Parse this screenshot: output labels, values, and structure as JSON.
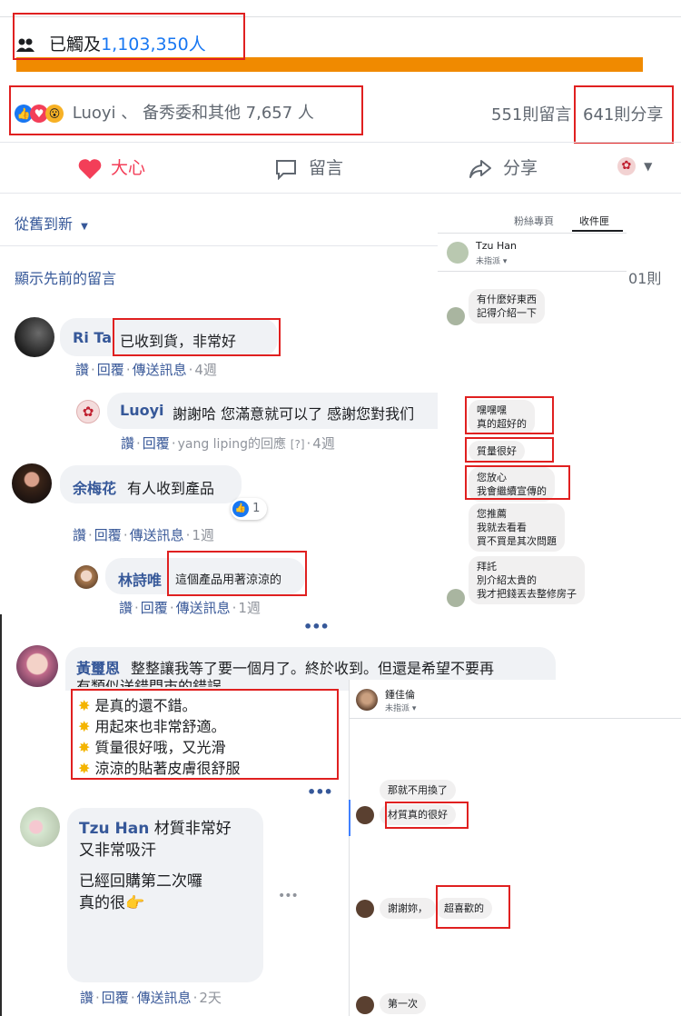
{
  "reach": {
    "prefix": "已觸及",
    "count": "1,103,350人"
  },
  "reactions": {
    "names": "Luoyi 、 备秀委和其他 7,657 人",
    "comments": "551則留言",
    "shares": "641則分享"
  },
  "actions": {
    "love": "大心",
    "comment": "留言",
    "share": "分享"
  },
  "sort": {
    "label": "從舊到新"
  },
  "show_previous": "顯示先前的留言",
  "comments_count_cut": "01則",
  "comment_actions": {
    "like": "讚",
    "reply": "回覆",
    "send": "傳送訊息"
  },
  "comments": [
    {
      "name": "Ri Ta",
      "text": "已收到貨，非常好",
      "time": "4週"
    },
    {
      "name": "Luoyi",
      "text": "謝謝哈 您滿意就可以了 感謝您對我们",
      "replied_by": "yang liping的回應",
      "badge": "[?]",
      "time": "4週"
    },
    {
      "name": "余梅花",
      "text": "有人收到產品",
      "reaction_count": "1",
      "time": "1週"
    },
    {
      "name": "林詩唯",
      "text": "這個產品用著涼涼的",
      "time": "1週"
    },
    {
      "name": "黃璽恩",
      "text1": "整整讓我等了要一個月了。終於收到。但還是希望不要再",
      "text2": "有類似送錯門市的錯誤。",
      "bullets": [
        "是真的還不錯。",
        "用起來也非常舒適。",
        "質量很好哦，又光滑",
        "涼涼的貼著皮膚很舒服"
      ]
    },
    {
      "name": "Tzu Han",
      "text1": "材質非常好",
      "text2": "又非常吸汗",
      "text3": "已經回購第二次囉",
      "text4": "真的很",
      "time": "2天"
    }
  ],
  "inbox1": {
    "tab_page": "粉絲專頁",
    "tab_inbox": "收件匣",
    "contact": "Tzu Han",
    "status": "未指派",
    "messages": [
      {
        "lines": [
          "有什麼好東西",
          "記得介紹一下"
        ]
      },
      {
        "lines": [
          "嘿嘿嘿",
          "真的超好的"
        ]
      },
      {
        "lines": [
          "質量很好"
        ]
      },
      {
        "lines": [
          "您放心",
          "我會繼續宣傳的"
        ]
      },
      {
        "lines": [
          "您推薦",
          "我就去看看",
          "買不買是其次問題"
        ]
      },
      {
        "lines": [
          "拜託",
          "別介紹太貴的",
          "我才把錢丟去整修房子"
        ]
      }
    ]
  },
  "inbox2": {
    "contact": "鍾佳倫",
    "status": "未指派",
    "messages": [
      "那就不用換了",
      "材質真的很好",
      "謝謝妳，",
      "超喜歡的",
      "第一次"
    ]
  },
  "colors": {
    "accent": "#1877f2",
    "love": "#f33e58",
    "highlight": "#e02020",
    "progress": "#f08a00"
  }
}
